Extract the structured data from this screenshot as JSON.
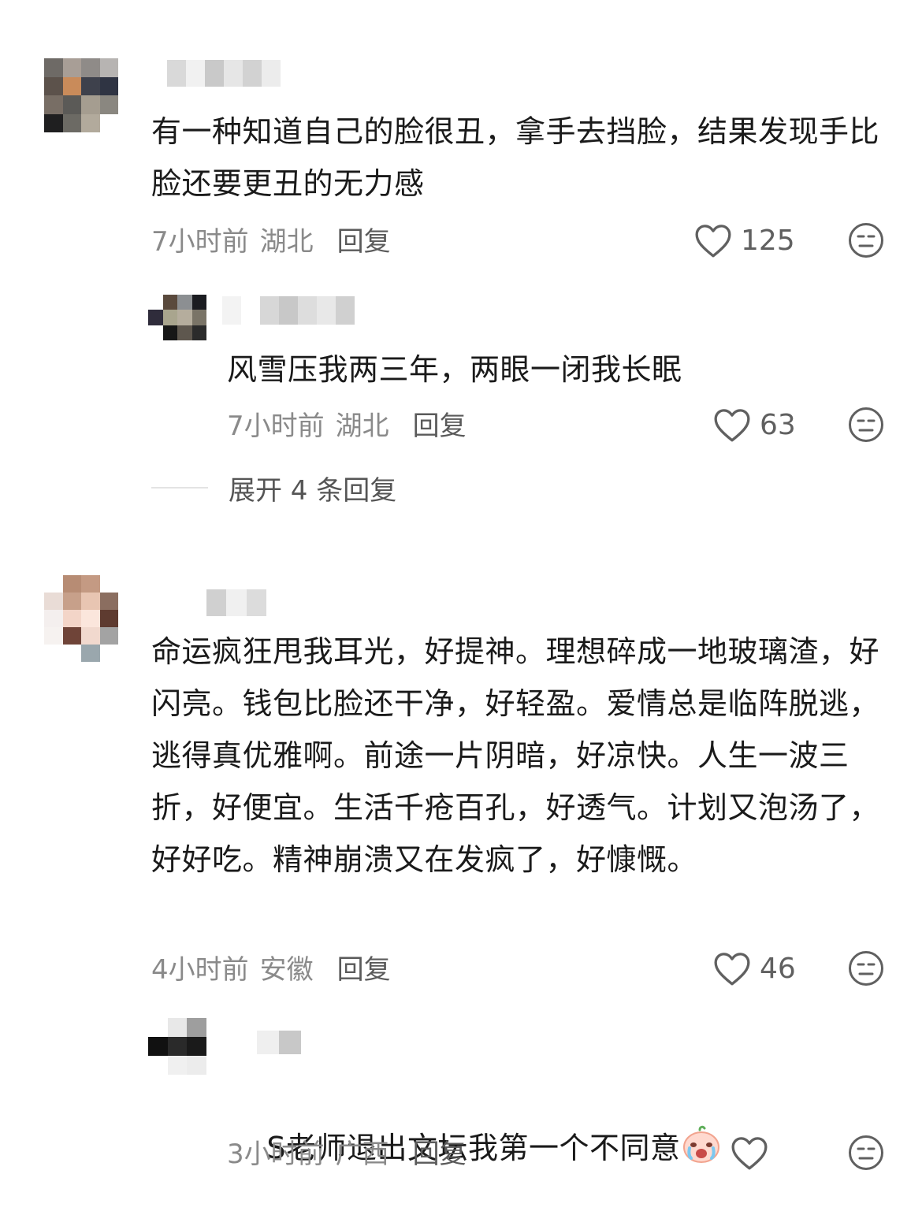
{
  "comments": [
    {
      "text": "有一种知道自己的脸很丑，拿手去挡脸，结果发现手比脸还要更丑的无力感",
      "time": "7小时前",
      "location": "湖北",
      "reply_label": "回复",
      "likes": "125"
    },
    {
      "text": "风雪压我两三年，两眼一闭我长眠",
      "time": "7小时前",
      "location": "湖北",
      "reply_label": "回复",
      "likes": "63"
    },
    {
      "text": "命运疯狂甩我耳光，好提神。理想碎成一地玻璃渣，好闪亮。钱包比脸还干净，好轻盈。爱情总是临阵脱逃，逃得真优雅啊。前途一片阴暗，好凉快。人生一波三折，好便宜。生活千疮百孔，好透气。计划又泡汤了，好好吃。精神崩溃又在发疯了，好慷慨。",
      "time": "4小时前",
      "location": "安徽",
      "reply_label": "回复",
      "likes": "46"
    },
    {
      "text": "S老师退出文坛我第一个不同意",
      "emoji": "crying-face-emoji",
      "time": "3小时前",
      "location": "广西",
      "reply_label": "回复",
      "likes": ""
    }
  ],
  "expand_replies_label": "展开 4 条回复",
  "icons": {
    "like": "heart-outline-icon",
    "dislike": "neutral-face-icon"
  },
  "colors": {
    "text": "#1a1a1a",
    "meta": "#8a8a8a",
    "icon": "#606060"
  }
}
